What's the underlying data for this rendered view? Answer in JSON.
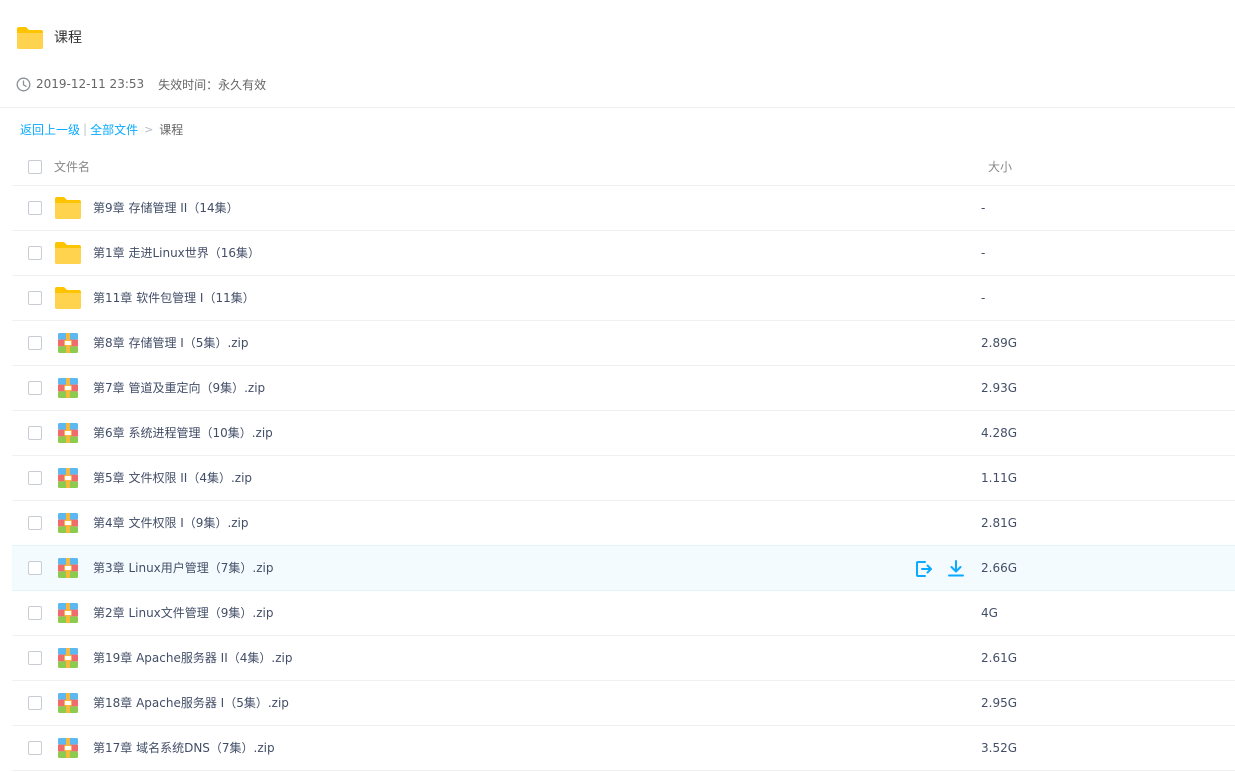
{
  "header": {
    "title": "课程",
    "share_time": "2019-12-11 23:53",
    "expire_label": "失效时间：",
    "expire_value": "永久有效"
  },
  "breadcrumb": {
    "back_label": "返回上一级",
    "separator": "|",
    "root_label": "全部文件",
    "arrow": ">",
    "current_label": "课程"
  },
  "list": {
    "name_header": "文件名",
    "size_header": "大小",
    "rows": [
      {
        "type": "folder",
        "name": "第9章 存储管理 II（14集）",
        "size": "-"
      },
      {
        "type": "folder",
        "name": "第1章 走进Linux世界（16集）",
        "size": "-"
      },
      {
        "type": "folder",
        "name": "第11章 软件包管理 I（11集）",
        "size": "-"
      },
      {
        "type": "zip",
        "name": "第8章 存储管理 I（5集）.zip",
        "size": "2.89G"
      },
      {
        "type": "zip",
        "name": "第7章 管道及重定向（9集）.zip",
        "size": "2.93G"
      },
      {
        "type": "zip",
        "name": "第6章 系统进程管理（10集）.zip",
        "size": "4.28G"
      },
      {
        "type": "zip",
        "name": "第5章 文件权限 II（4集）.zip",
        "size": "1.11G"
      },
      {
        "type": "zip",
        "name": "第4章 文件权限 I（9集）.zip",
        "size": "2.81G"
      },
      {
        "type": "zip",
        "name": "第3章 Linux用户管理（7集）.zip",
        "size": "2.66G",
        "hover": true
      },
      {
        "type": "zip",
        "name": "第2章 Linux文件管理（9集）.zip",
        "size": "4G"
      },
      {
        "type": "zip",
        "name": "第19章 Apache服务器 II（4集）.zip",
        "size": "2.61G"
      },
      {
        "type": "zip",
        "name": "第18章 Apache服务器 I（5集）.zip",
        "size": "2.95G"
      },
      {
        "type": "zip",
        "name": "第17章 域名系统DNS（7集）.zip",
        "size": "3.52G"
      }
    ]
  },
  "icons": {
    "folder": "folder-icon",
    "zip": "zip-archive-icon",
    "clock": "clock-icon",
    "save": "save-to-drive-icon",
    "download": "download-icon"
  },
  "colors": {
    "accent": "#09aaff",
    "folder": "#ffd34d",
    "text": "#424e67",
    "hover_bg": "#f4fbff"
  }
}
